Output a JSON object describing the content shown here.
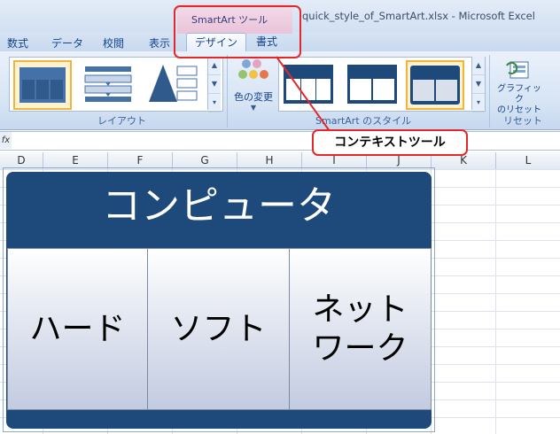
{
  "window": {
    "title": "quick_style_of_SmartArt.xlsx - Microsoft Excel"
  },
  "ribbon_tabs": [
    "数式",
    "データ",
    "校閲",
    "表示"
  ],
  "context_group": {
    "title": "SmartArt ツール",
    "tabs": [
      "デザイン",
      "書式"
    ],
    "active_tab": "デザイン"
  },
  "ribbon_groups": {
    "layout_label": "レイアウト",
    "style_label": "SmartArt のスタイル",
    "reset_label": "リセット",
    "change_colors": "色の変更",
    "reset_graphic": "グラフィック\nのリセット"
  },
  "formula_bar": {
    "fx_label": "fx",
    "value": ""
  },
  "columns": [
    "D",
    "E",
    "F",
    "G",
    "H",
    "I",
    "J",
    "K",
    "L"
  ],
  "smartart": {
    "title": "コンピュータ",
    "cells": [
      "ハード",
      "ソフト",
      "ネット\nワーク"
    ]
  },
  "callout": "コンテキストツール",
  "colors": {
    "accent_red": "#e2282a",
    "smartart_dark": "#1d4a7a",
    "selection_gold": "#f4b33a"
  }
}
